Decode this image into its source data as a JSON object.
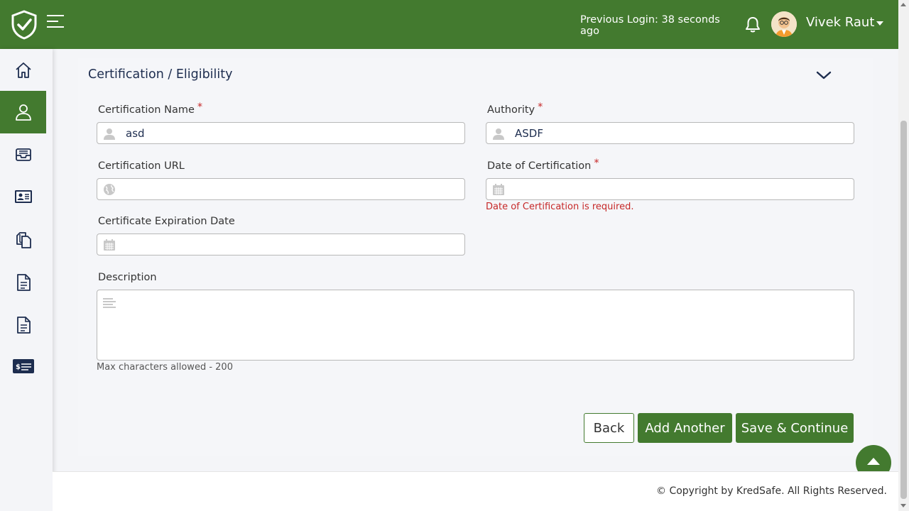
{
  "header": {
    "previous_login": "Previous Login: 38 seconds ago",
    "user_name": "Vivek Raut",
    "brand_color": "#437a2f"
  },
  "sidebar": {
    "items": [
      {
        "icon": "home-icon",
        "active": false
      },
      {
        "icon": "user-icon",
        "active": true
      },
      {
        "icon": "inbox-tray-icon",
        "active": false
      },
      {
        "icon": "id-card-icon",
        "active": false
      },
      {
        "icon": "documents-icon",
        "active": false
      },
      {
        "icon": "document-icon",
        "active": false
      },
      {
        "icon": "document-icon",
        "active": false
      },
      {
        "icon": "payment-card-icon",
        "active": false
      }
    ]
  },
  "form": {
    "section_title": "Certification / Eligibility",
    "certification_name": {
      "label": "Certification Name",
      "required": "*",
      "value": "asd"
    },
    "authority": {
      "label": "Authority",
      "required": "*",
      "value": "ASDF"
    },
    "certification_url": {
      "label": "Certification URL",
      "value": ""
    },
    "date_of_certification": {
      "label": "Date of Certification",
      "required": "*",
      "value": "",
      "error": "Date of Certification is required."
    },
    "expiration_date": {
      "label": "Certificate Expiration Date",
      "value": ""
    },
    "description": {
      "label": "Description",
      "value": "",
      "hint": "Max characters allowed - 200"
    }
  },
  "actions": {
    "back": "Back",
    "add_another": "Add Another",
    "save_continue": "Save & Continue"
  },
  "footer": {
    "copyright": "© Copyright by KredSafe. All Rights Reserved."
  },
  "colors": {
    "error": "#c62828",
    "title": "#1d2d4f"
  }
}
